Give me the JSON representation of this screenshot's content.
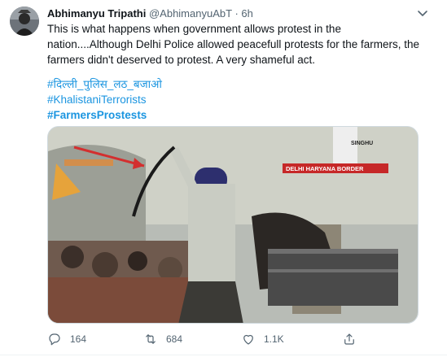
{
  "tweet": {
    "author_name": "Abhimanyu Tripathi",
    "handle": "@AbhimanyuAbT",
    "separator": "·",
    "time": "6h",
    "text_line1": "This is what happens when government allows protest in the",
    "text_line2": "nation....Although Delhi Police allowed peacefull protests for the farmers, the",
    "text_line3": "farmers didn't deserved to protest. A very shameful act.",
    "hashtags": [
      "#दिल्ली_पुलिस_लठ_बजाओ",
      "#KhalistaniTerrorists",
      "#FarmersProstests"
    ]
  },
  "media": {
    "overlay_top": "SINGHU",
    "overlay_banner": "DELHI HARYANA BORDER"
  },
  "actions": {
    "reply_count": "164",
    "retweet_count": "684",
    "like_count": "1.1K"
  },
  "colors": {
    "link": "#1b95e0",
    "secondary_text": "#536471",
    "banner_red": "#c62828"
  }
}
